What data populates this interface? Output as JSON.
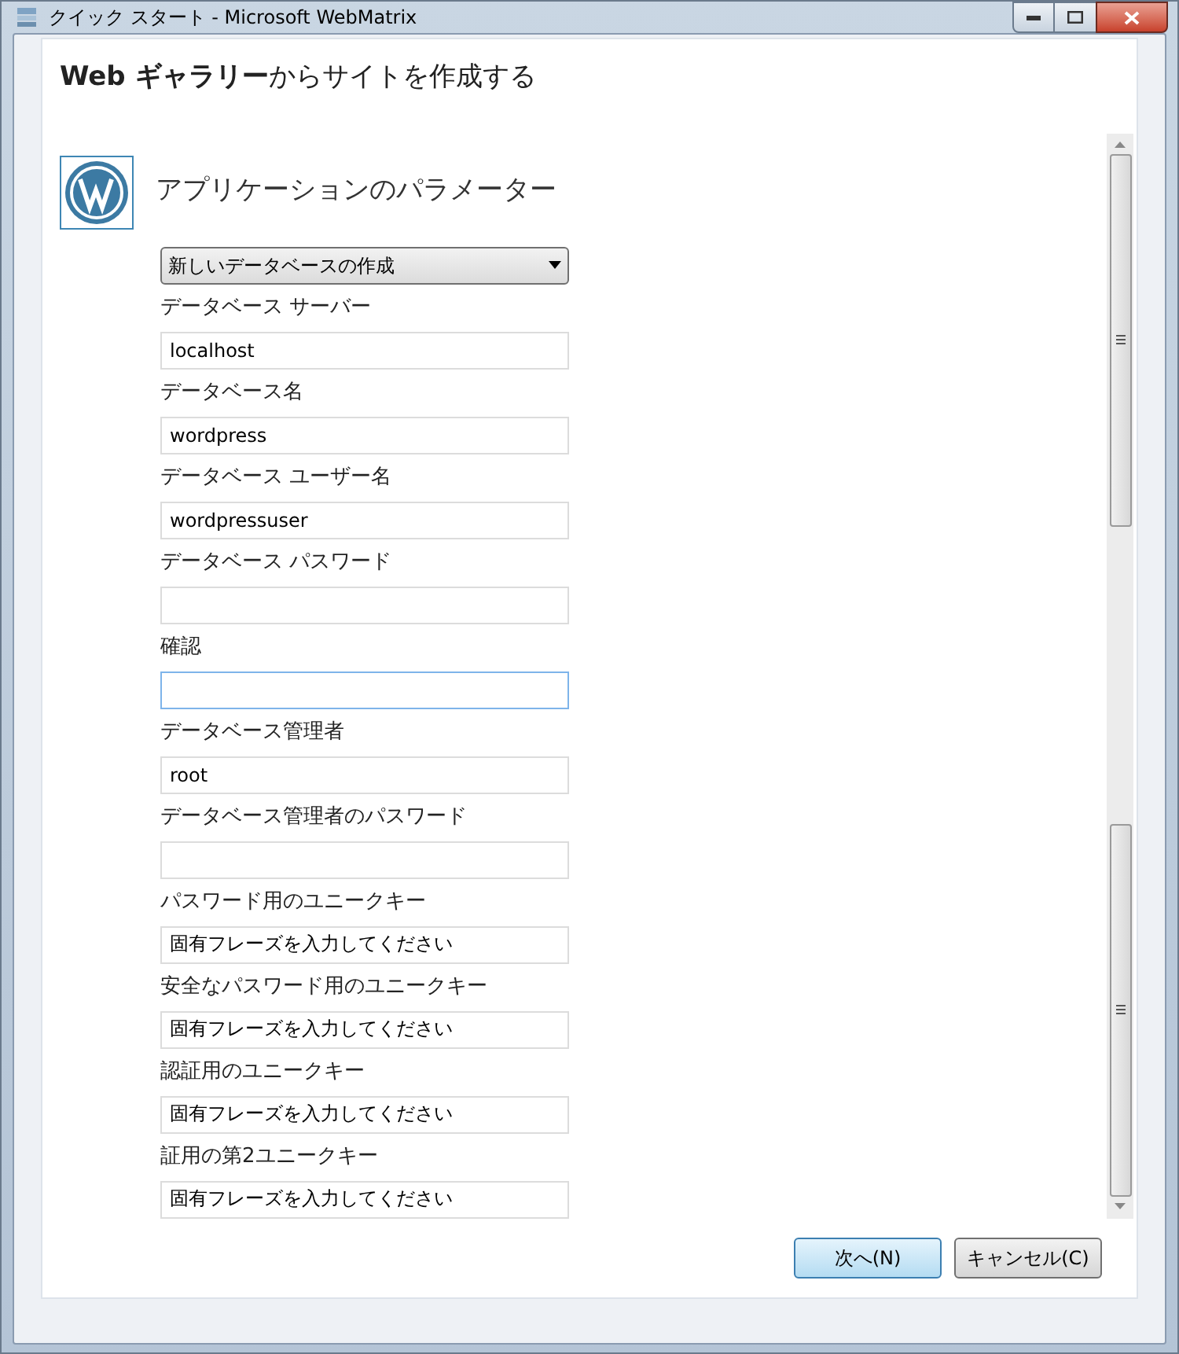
{
  "window": {
    "title": "クイック スタート - Microsoft WebMatrix"
  },
  "heading": "**Web ギャラリー**からサイトを作成する",
  "section_title": "アプリケーションのパラメーター",
  "fields": [
    {
      "kind": "select",
      "value": "新しいデータベースの作成"
    },
    {
      "kind": "text",
      "label": "データベース サーバー",
      "value": "localhost",
      "focused": false
    },
    {
      "kind": "text",
      "label": "データベース名",
      "value": "wordpress",
      "focused": false
    },
    {
      "kind": "text",
      "label": "データベース ユーザー名",
      "value": "wordpressuser",
      "focused": false
    },
    {
      "kind": "text",
      "label": "データベース パスワード",
      "focused": false
    },
    {
      "kind": "text",
      "label": "確認",
      "focused": true
    },
    {
      "kind": "text",
      "label": "データベース管理者",
      "value": "root",
      "focused": false
    },
    {
      "kind": "text",
      "label": "データベース管理者のパスワード",
      "focused": false
    },
    {
      "kind": "text",
      "label": "パスワード用のユニークキー",
      "value": "固有フレーズを入力してください",
      "focused": false
    },
    {
      "kind": "text",
      "label": "安全なパスワード用のユニークキー",
      "value": "固有フレーズを入力してください",
      "focused": false
    },
    {
      "kind": "text",
      "label": "認証用のユニークキー",
      "value": "固有フレーズを入力してください",
      "focused": false
    },
    {
      "kind": "text",
      "label": "証用の第2ユニークキー",
      "value": "固有フレーズを入力してください",
      "focused": false
    }
  ],
  "buttons": [
    {
      "label": "次へ(N)",
      "default": true
    },
    {
      "label": "キャンセル(C)",
      "default": false
    }
  ]
}
